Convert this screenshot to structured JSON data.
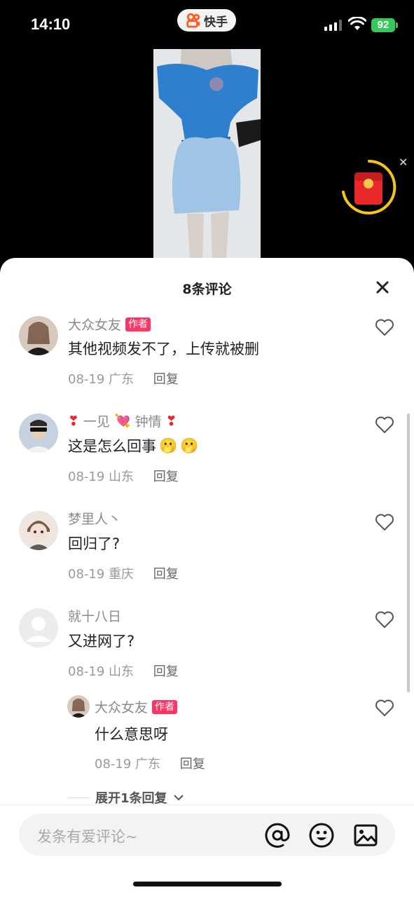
{
  "status": {
    "time": "14:10",
    "app_name": "快手",
    "battery": "92"
  },
  "sheet": {
    "title": "8条评论"
  },
  "comments": [
    {
      "user": "大众女友",
      "tag": "作者",
      "text": "其他视频发不了，上传就被删",
      "date": "08-19",
      "location": "广东",
      "reply": "回复"
    },
    {
      "user_parts": [
        "❣",
        "一见",
        "💘",
        "钟情",
        "❣"
      ],
      "text": "这是怎么回事",
      "emoji": [
        "🫢",
        "🫢"
      ],
      "date": "08-19",
      "location": "山东",
      "reply": "回复"
    },
    {
      "user": "梦里人丶",
      "text": "回归了?",
      "date": "08-19",
      "location": "重庆",
      "reply": "回复"
    },
    {
      "user": "就十八日",
      "text": "又进网了?",
      "date": "08-19",
      "location": "山东",
      "reply": "回复"
    }
  ],
  "reply_comment": {
    "user": "大众女友",
    "tag": "作者",
    "text": "什么意思呀",
    "date": "08-19",
    "location": "广东",
    "reply": "回复"
  },
  "expand": {
    "label": "展开1条回复"
  },
  "input": {
    "placeholder": "发条有爱评论~"
  },
  "icons": {
    "at": "at-icon",
    "emoji": "emoji-icon",
    "image": "image-icon",
    "like": "heart-icon",
    "close": "close-icon"
  },
  "colors": {
    "author_tag": "#fe3666",
    "battery": "#35c759",
    "red_packet": "#e8282b",
    "ring": "#f5c518"
  }
}
